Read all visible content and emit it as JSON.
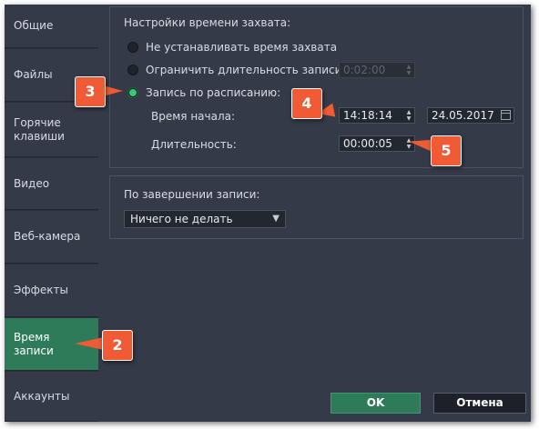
{
  "sidebar": {
    "items": [
      {
        "label": "Общие"
      },
      {
        "label": "Файлы"
      },
      {
        "label": "Горячие клавиши"
      },
      {
        "label": "Видео"
      },
      {
        "label": "Веб-камера"
      },
      {
        "label": "Эффекты"
      },
      {
        "label": "Время записи"
      },
      {
        "label": "Аккаунты"
      }
    ],
    "active_index": 6
  },
  "capture": {
    "title": "Настройки времени захвата:",
    "options": [
      {
        "label": "Не устанавливать время захвата",
        "selected": false
      },
      {
        "label": "Ограничить длительность записи:",
        "selected": false
      },
      {
        "label": "Запись по расписанию:",
        "selected": true
      }
    ],
    "limit_value": "0:02:00",
    "start_label": "Время начала:",
    "start_time": "14:18:14",
    "start_date": "24.05.2017",
    "duration_label": "Длительность:",
    "duration_value": "00:00:05"
  },
  "after": {
    "title": "По завершении записи:",
    "selected": "Ничего не делать"
  },
  "buttons": {
    "ok": "OK",
    "cancel": "Отмена"
  },
  "badges": [
    "2",
    "3",
    "4",
    "5"
  ],
  "colors": {
    "accent": "#2e7b5a",
    "badge": "#f05a35",
    "radio_on": "#3fc37e"
  }
}
